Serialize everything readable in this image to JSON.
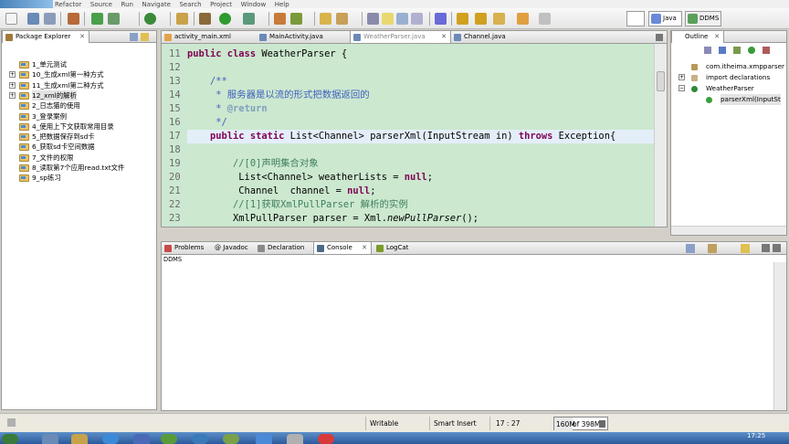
{
  "menubar": {
    "items": [
      "Refactor",
      "Source",
      "Run",
      "Navigate",
      "Search",
      "Project",
      "Window",
      "Help"
    ]
  },
  "perspectives": {
    "java": "Java",
    "ddms": "DDMS"
  },
  "package_explorer": {
    "title": "Package Explorer",
    "items": [
      {
        "label": "1_单元测试",
        "expandable": false
      },
      {
        "label": "10_生成xml第一种方式",
        "expandable": true
      },
      {
        "label": "11_生成xml第二种方式",
        "expandable": true
      },
      {
        "label": "12_xml的解析",
        "expandable": true,
        "selected": true
      },
      {
        "label": "2_日志猫的使用",
        "expandable": false
      },
      {
        "label": "3_登录案例",
        "expandable": false
      },
      {
        "label": "4_使用上下文获取常用目录",
        "expandable": false
      },
      {
        "label": "5_把数据保存到sd卡",
        "expandable": false
      },
      {
        "label": "6_获取sd卡空间数据",
        "expandable": false
      },
      {
        "label": "7_文件的权限",
        "expandable": false
      },
      {
        "label": "8_读取第7个应用read.txt文件",
        "expandable": false
      },
      {
        "label": "9_sp练习",
        "expandable": false
      }
    ]
  },
  "editor": {
    "tabs": [
      {
        "label": "activity_main.xml",
        "active": false
      },
      {
        "label": "MainActivity.java",
        "active": false
      },
      {
        "label": "WeatherParser.java",
        "active": true
      },
      {
        "label": "Channel.java",
        "active": false
      }
    ],
    "line_numbers": [
      "11",
      "12",
      "13",
      "14",
      "15",
      "16",
      "17",
      "18",
      "19",
      "20",
      "21",
      "22",
      "23"
    ],
    "lines": {
      "l11_kw": "public class",
      "l11_rest": " WeatherParser {",
      "l13": "    /**",
      "l14": "     * 服务器是以流的形式把数据返回的",
      "l15_a": "     * ",
      "l15_tag": "@return",
      "l16": "     */",
      "l17_kw1": "    public static",
      "l17_a": " List<Channel> parserXml(InputStream in) ",
      "l17_kw2": "throws",
      "l17_b": " Exception{",
      "l19": "        //[0]声明集合对象",
      "l20_a": "         List<Channel> weatherLists = ",
      "l20_kw": "null",
      "l20_b": ";",
      "l21_a": "         Channel  channel = ",
      "l21_kw": "null",
      "l21_b": ";",
      "l22": "        //[1]获取XmlPullParser 解析的实例",
      "l23_a": "        XmlPullParser parser = Xml.",
      "l23_it": "newPullParser",
      "l23_b": "();"
    }
  },
  "outline": {
    "title": "Outline",
    "items": [
      "com.itheima.xmpparser",
      "import declarations",
      "WeatherParser",
      "parserXml(InputSt"
    ]
  },
  "bottom": {
    "tabs": [
      {
        "label": "Problems"
      },
      {
        "label": "@ Javadoc"
      },
      {
        "label": "Declaration"
      },
      {
        "label": "Console",
        "active": true
      },
      {
        "label": "LogCat"
      }
    ],
    "console_title": "DDMS"
  },
  "status": {
    "writable": "Writable",
    "insert_mode": "Smart Insert",
    "position": "17 : 27",
    "heap_used": "160M",
    "heap_total": "of 398M"
  },
  "taskbar": {
    "clock": "17:25"
  },
  "colors": {
    "editor_bg": "#cce8cf",
    "current_line": "#e4eef9",
    "keyword": "#7f0055",
    "comment": "#3f7f5f",
    "javadoc": "#3f5fbf"
  }
}
